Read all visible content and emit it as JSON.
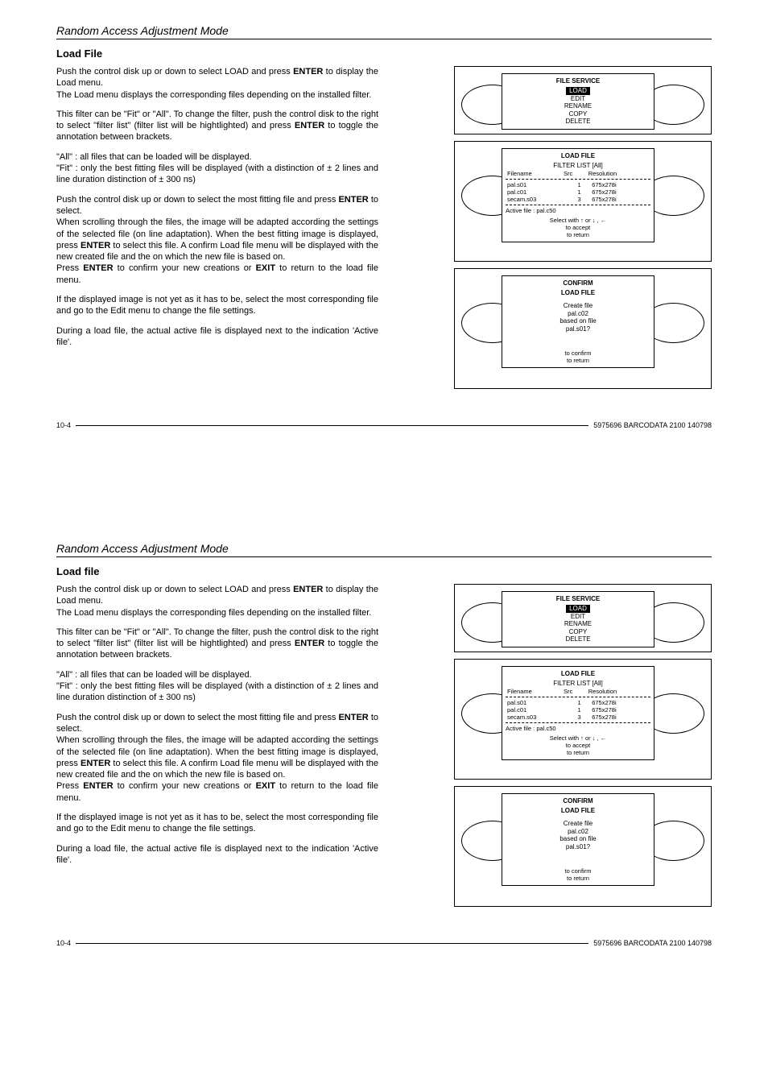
{
  "sections": [
    {
      "title": "Random Access Adjustment Mode",
      "heading": "Load File",
      "paragraphs": [
        "Push the control disk up or down to select LOAD and press <b>ENTER</b> to display the Load menu.<br>The Load menu displays the corresponding files depending on the installed filter.",
        "This filter can be \"Fit\" or \"All\".  To change the filter, push the control disk to the right to select  \"filter list\" (filter list will be hightlighted) and press <b>ENTER</b> to toggle the annotation between brackets.",
        "\"All\" : all files that can be loaded will be displayed.<br>\"Fit\" : only the best fitting files will  be displayed (with a distinction of ± 2 lines and line duration distinction of ± 300 ns)",
        "Push the control disk up or down to select the most fitting file and press <b>ENTER</b> to select.<br>When scrolling through the files, the image will be adapted according the settings of the selected file (on line adaptation).  When the best fitting image is displayed, press <b>ENTER</b> to select this file.  A confirm Load file menu will be displayed with the new created file and the on which the new file is based on.<br>Press <b>ENTER</b> to confirm your new creations or <b>EXIT</b> to return to the load file menu.",
        "If the displayed image is not yet as it has to be, select the most corresponding file and go to the Edit menu to change the file settings.",
        "During a load file, the actual active file is displayed next to the indication 'Active file'."
      ],
      "footer_left": "10-4",
      "footer_right": "5975696 BARCODATA 2100 140798"
    },
    {
      "title": "Random Access Adjustment Mode",
      "heading": "Load file",
      "paragraphs": [
        "Push the control disk up or down to select LOAD and press <b>ENTER</b> to display the Load menu.<br>The Load menu displays the corresponding files depending on the installed filter.",
        "This filter can be \"Fit\" or \"All\".  To change the filter, push the control disk to the right to select  \"filter list\" (filter list will be hightlighted) and press <b>ENTER</b> to toggle the annotation between brackets.",
        "\"All\" : all files that can be loaded will be displayed.<br>\"Fit\" : only the best fitting files will  be displayed (with a distinction of ± 2 lines and line duration distinction of ± 300 ns)",
        "Push the control disk up or down to select the most fitting file and press <b>ENTER</b> to select.<br>When scrolling through the files, the image will be adapted according the settings of the selected file (on line adaptation).  When the best fitting image is displayed, press <b>ENTER</b> to select this file.  A confirm Load file menu will be displayed with the new created file and the on which the new file is based on.<br>Press <b>ENTER</b> to confirm your new creations or <b>EXIT</b> to return to the load file menu.",
        "If the displayed image is not yet as it has to be, select the most corresponding file and go to the Edit menu to change the file settings.",
        "During a load file, the actual active file is displayed next to the indication 'Active file'."
      ],
      "footer_left": "10-4",
      "footer_right": "5975696 BARCODATA 2100 140798"
    }
  ],
  "diagrams": {
    "file_service": {
      "title": "FILE SERVICE",
      "items": [
        "LOAD",
        "EDIT",
        "RENAME",
        "COPY",
        "DELETE"
      ],
      "highlight_index": 0
    },
    "load_file": {
      "title": "LOAD FILE",
      "filter_label": "FILTER LIST [All]",
      "columns": [
        "Filename",
        "Src",
        "Resolution"
      ],
      "rows": [
        [
          "pal.s01",
          "1",
          "675x278i"
        ],
        [
          "pal.c01",
          "1",
          "675x278i"
        ],
        [
          "secam.s03",
          "3",
          "675x278i"
        ]
      ],
      "active_label": "Active file  :  pal.c50",
      "hints": [
        "Select with ↑ or ↓ , ←",
        "<ENTER> to accept",
        "<EXIT> to return"
      ]
    },
    "confirm": {
      "title1": "CONFIRM",
      "title2": "LOAD FILE",
      "lines": [
        "Create file",
        "pal.c02",
        "based on file",
        "pal.s01?"
      ],
      "hints": [
        "<ENTER> to confirm",
        "<EXIT> to return"
      ]
    }
  }
}
